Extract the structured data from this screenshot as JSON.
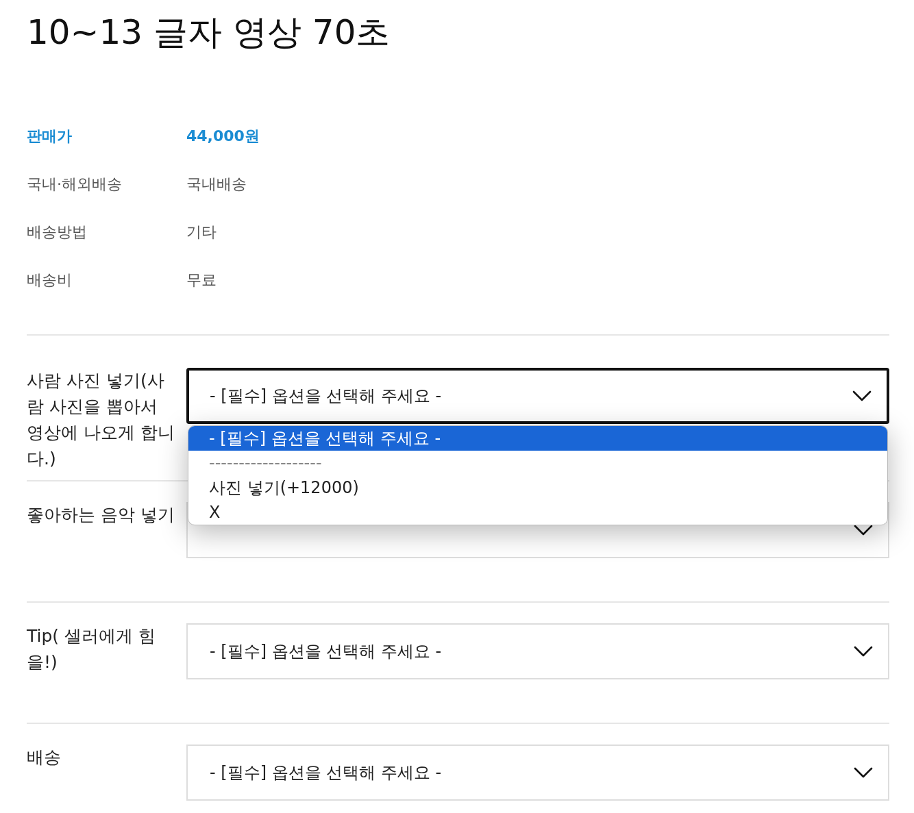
{
  "title": "10~13 글자 영상 70초",
  "price": {
    "label": "판매가",
    "value": "44,000원"
  },
  "info": [
    {
      "label": "국내·해외배송",
      "value": "국내배송"
    },
    {
      "label": "배송방법",
      "value": "기타"
    },
    {
      "label": "배송비",
      "value": "무료"
    }
  ],
  "options": [
    {
      "label": "사람 사진 넣기(사람 사진을 뽑아서 영상에 나오게 합니다.)",
      "value": "- [필수] 옵션을 선택해 주세요 -",
      "focused": true,
      "menu": [
        {
          "label": "- [필수] 옵션을 선택해 주세요 -",
          "selected": true,
          "disabled": false
        },
        {
          "label": "-------------------",
          "selected": false,
          "disabled": true
        },
        {
          "label": "사진 넣기(+12000)",
          "selected": false,
          "disabled": false
        },
        {
          "label": "X",
          "selected": false,
          "disabled": false
        }
      ]
    },
    {
      "label": "좋아하는 음악 넣기",
      "focused": false
    },
    {
      "label": "Tip( 셀러에게 힘을!)",
      "value": "- [필수] 옵션을 선택해 주세요 -",
      "focused": false
    },
    {
      "label": "배송",
      "value": "- [필수] 옵션을 선택해 주세요 -",
      "focused": false
    }
  ]
}
